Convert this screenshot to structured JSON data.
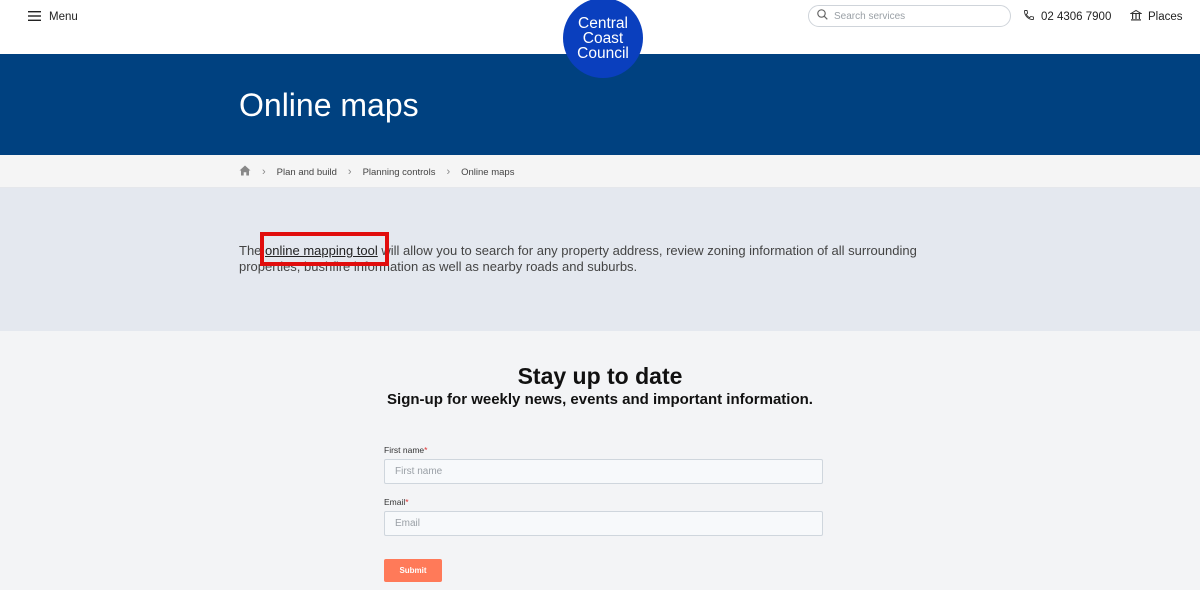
{
  "header": {
    "menu_label": "Menu",
    "logo_lines": [
      "Central",
      "Coast",
      "Council"
    ],
    "search_placeholder": "Search services",
    "phone": "02 4306 7900",
    "places_label": "Places"
  },
  "hero": {
    "title": "Online maps"
  },
  "breadcrumb": {
    "items": [
      "Plan and build",
      "Planning controls",
      "Online maps"
    ]
  },
  "content": {
    "prefix": "The ",
    "link_text": "online mapping tool",
    "suffix": " will allow you to search for any property address, review zoning information of all surrounding properties, bushfire information as well as nearby roads and suburbs."
  },
  "newsletter": {
    "title": "Stay up to date",
    "subtitle": "Sign-up for weekly news, events and important information.",
    "first_name_label": "First name",
    "first_name_placeholder": "First name",
    "email_label": "Email",
    "email_placeholder": "Email",
    "required_mark": "*",
    "submit_label": "Submit"
  },
  "colors": {
    "hero_bg": "#004180",
    "logo_bg": "#0a3fbe",
    "submit_bg": "#ff7a59",
    "highlight": "#e10d0d"
  }
}
